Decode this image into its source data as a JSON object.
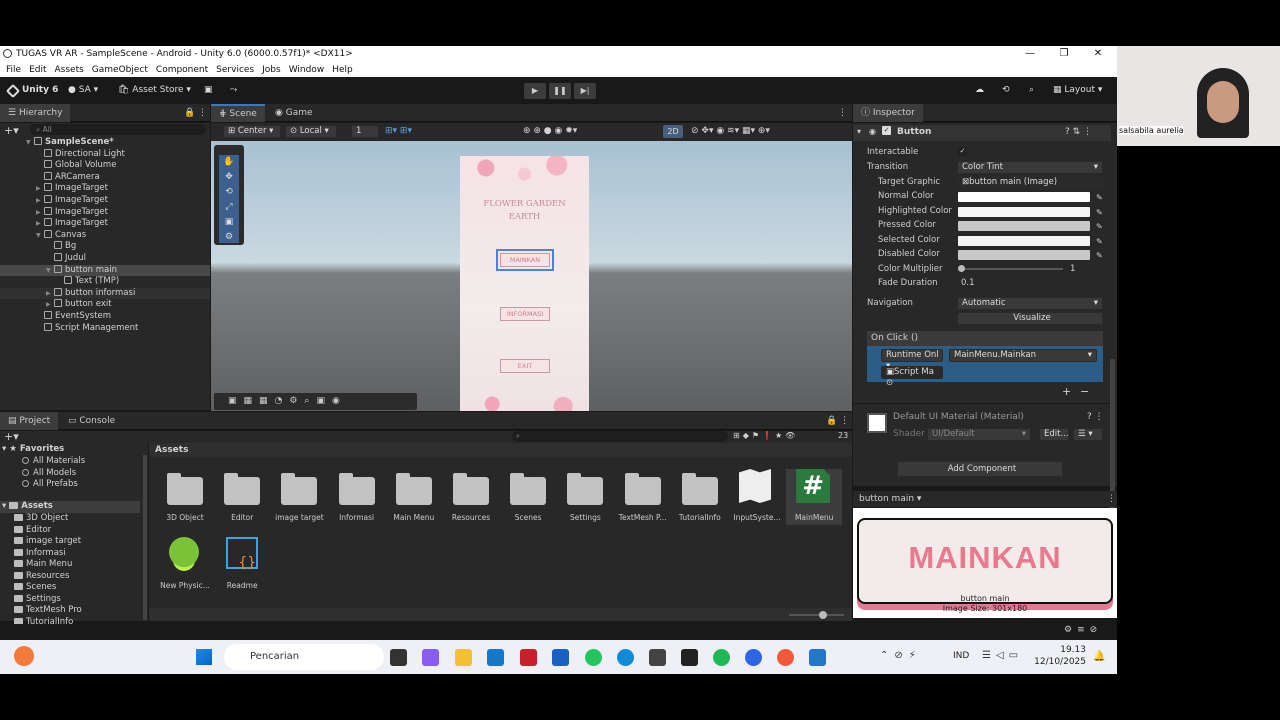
{
  "window": {
    "title": "TUGAS VR AR - SampleScene - Android - Unity 6.0 (6000.0.57f1)* <DX11>",
    "min": "—",
    "max": "❐",
    "close": "✕"
  },
  "menu": [
    "File",
    "Edit",
    "Assets",
    "GameObject",
    "Component",
    "Services",
    "Jobs",
    "Window",
    "Help"
  ],
  "toolbar": {
    "unity": "Unity 6",
    "account": "SA",
    "asset_store": "Asset Store",
    "layout": "Layout"
  },
  "hierarchy": {
    "tab": "Hierarchy",
    "search": "All",
    "items": [
      {
        "label": "SampleScene*",
        "indent": 0,
        "expanded": true,
        "bold": true
      },
      {
        "label": "Directional Light",
        "indent": 1
      },
      {
        "label": "Global Volume",
        "indent": 1
      },
      {
        "label": "ARCamera",
        "indent": 1
      },
      {
        "label": "ImageTarget",
        "indent": 1,
        "collapsed": true
      },
      {
        "label": "ImageTarget",
        "indent": 1,
        "collapsed": true
      },
      {
        "label": "ImageTarget",
        "indent": 1,
        "collapsed": true
      },
      {
        "label": "ImageTarget",
        "indent": 1,
        "collapsed": true
      },
      {
        "label": "Canvas",
        "indent": 1,
        "expanded": true
      },
      {
        "label": "Bg",
        "indent": 2
      },
      {
        "label": "Judul",
        "indent": 2
      },
      {
        "label": "button main",
        "indent": 2,
        "expanded": true,
        "selected": true
      },
      {
        "label": "Text (TMP)",
        "indent": 3
      },
      {
        "label": "button informasi",
        "indent": 2,
        "collapsed": true,
        "hover": true
      },
      {
        "label": "button exit",
        "indent": 2,
        "collapsed": true
      },
      {
        "label": "EventSystem",
        "indent": 1
      },
      {
        "label": "Script Management",
        "indent": 1
      }
    ]
  },
  "scene": {
    "tabs": [
      "Scene",
      "Game"
    ],
    "pivot": "Center",
    "space": "Local",
    "grid": "1",
    "mode2d": "2D",
    "ui": {
      "title": "FLOWER GARDEN\nEARTH",
      "btn_main": "MAINKAN",
      "btn_info": "INFORMASI",
      "btn_exit": "EXIT"
    }
  },
  "inspector": {
    "tab": "Inspector",
    "component": "Button",
    "rows": {
      "interactable": "Interactable",
      "interactable_val": "✓",
      "transition": "Transition",
      "transition_val": "Color Tint",
      "target": "Target Graphic",
      "target_val": "button main (Image)",
      "normal": "Normal Color",
      "highlighted": "Highlighted Color",
      "pressed": "Pressed Color",
      "selected": "Selected Color",
      "disabled": "Disabled Color",
      "multiplier": "Color Multiplier",
      "multiplier_val": "1",
      "multiplier_level": 0,
      "fade": "Fade Duration",
      "fade_val": "0.1",
      "navigation": "Navigation",
      "navigation_val": "Automatic",
      "visualize": "Visualize",
      "onclick": "On Click ()",
      "runtime": "Runtime Onl",
      "method": "MainMenu.Mainkan",
      "script": "Script Ma",
      "plus": "+",
      "minus": "−"
    },
    "material": "Default UI Material (Material)",
    "shader_label": "Shader",
    "shader_val": "UI/Default",
    "edit": "Edit...",
    "add_component": "Add Component",
    "preview": {
      "name": "button main",
      "text": "MAINKAN",
      "caption": "button main",
      "size": "Image Size: 301x180"
    },
    "colors": {
      "normal": "#ffffff",
      "highlighted": "#f5f5f5",
      "pressed": "#c8c8c8",
      "selected": "#f5f5f5",
      "disabled": "#c8c8c8"
    }
  },
  "project": {
    "tabs": [
      "Project",
      "Console"
    ],
    "count": "23",
    "favorites": "Favorites",
    "fav_items": [
      "All Materials",
      "All Models",
      "All Prefabs"
    ],
    "assets_label": "Assets",
    "tree": [
      "3D Object",
      "Editor",
      "image target",
      "Informasi",
      "Main Menu",
      "Resources",
      "Scenes",
      "Settings",
      "TextMesh Pro",
      "TutorialInfo"
    ],
    "breadcrumb": "Assets",
    "grid": [
      "3D Object",
      "Editor",
      "image target",
      "Informasi",
      "Main Menu",
      "Resources",
      "Scenes",
      "Settings",
      "TextMesh P...",
      "TutorialInfo",
      "InputSyste...",
      "MainMenu"
    ],
    "grid2": [
      "New Physic...",
      "Readme"
    ]
  },
  "taskbar": {
    "search": "Pencarian",
    "lang": "IND",
    "time": "19.13",
    "date": "12/10/2025"
  },
  "webcam": {
    "name": "salsabila aurelia"
  }
}
